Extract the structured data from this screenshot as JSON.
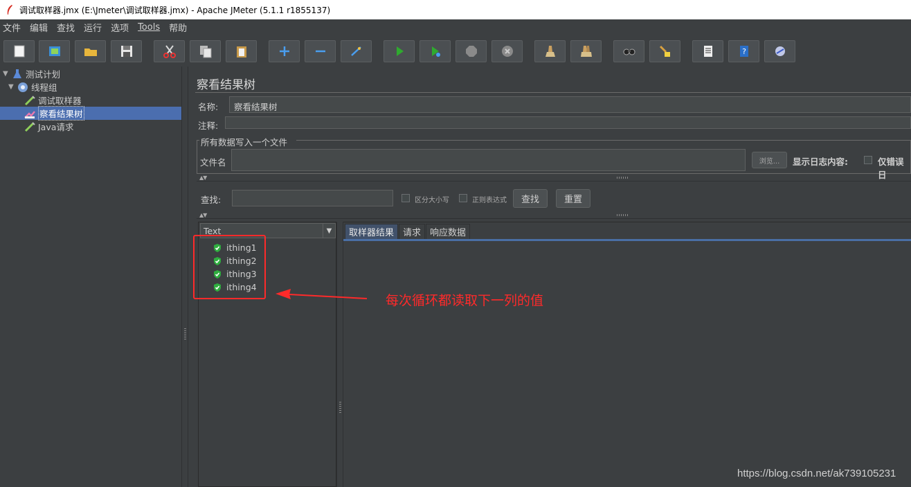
{
  "window": {
    "title": "调试取样器.jmx (E:\\Jmeter\\调试取样器.jmx) - Apache JMeter (5.1.1 r1855137)"
  },
  "menu": [
    "文件",
    "编辑",
    "查找",
    "运行",
    "选项",
    "Tools",
    "帮助"
  ],
  "toolbar": {
    "buttons": [
      "new-icon",
      "templates-icon",
      "open-icon",
      "save-icon",
      "cut-icon",
      "copy-icon",
      "paste-icon",
      "expand-icon",
      "collapse-icon",
      "toggle-icon",
      "start-icon",
      "start-no-pause-icon",
      "stop-icon",
      "shutdown-icon",
      "clear-icon",
      "clear-all-icon",
      "search-icon",
      "reset-search-icon",
      "function-helper-icon",
      "help-icon",
      "remote-icon"
    ]
  },
  "tree": {
    "items": [
      {
        "label": "测试计划",
        "icon": "test-plan-icon"
      },
      {
        "label": "线程组",
        "icon": "thread-group-icon"
      },
      {
        "label": "调试取样器",
        "icon": "sampler-icon"
      },
      {
        "label": "察看结果树",
        "icon": "listener-icon",
        "selected": true
      },
      {
        "label": "Java请求",
        "icon": "sampler-icon"
      }
    ]
  },
  "panel": {
    "title": "察看结果树",
    "name_label": "名称:",
    "name_value": "察看结果树",
    "comment_label": "注释:",
    "comment_value": "",
    "file_group_title": "所有数据写入一个文件",
    "filename_label": "文件名",
    "filename_value": "",
    "browse_button": "浏览...",
    "log_label": "显示日志内容:",
    "errors_only_label": "仅错误日"
  },
  "search": {
    "label": "查找:",
    "value": "",
    "case_sensitive_label": "区分大小写",
    "regex_label": "正则表达式",
    "find_button": "查找",
    "reset_button": "重置"
  },
  "results": {
    "renderer": "Text",
    "items": [
      "ithing1",
      "ithing2",
      "ithing3",
      "ithing4"
    ],
    "status_color": "#2fae3f",
    "tabs": [
      "取样器结果",
      "请求",
      "响应数据"
    ]
  },
  "annotation": {
    "text": "每次循环都读取下一列的值",
    "color": "#ff2a2a"
  },
  "watermark": "https://blog.csdn.net/ak739105231"
}
